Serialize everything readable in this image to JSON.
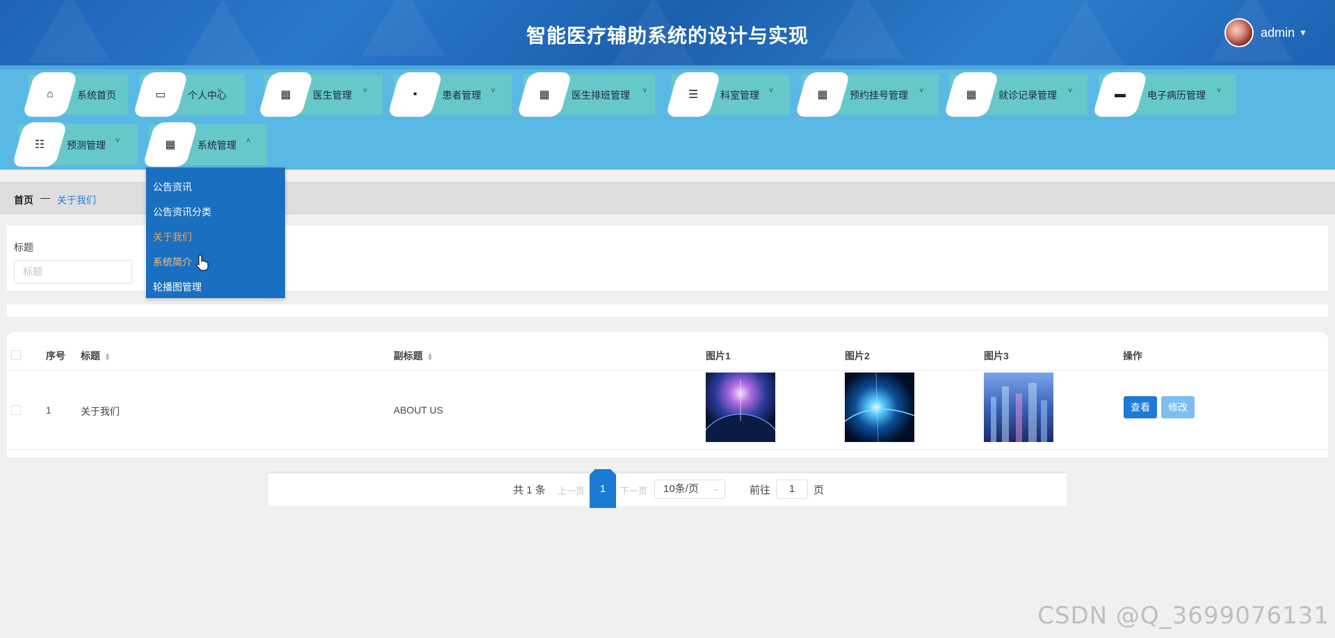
{
  "header": {
    "title": "智能医疗辅助系统的设计与实现",
    "username": "admin"
  },
  "nav": {
    "items": [
      {
        "label": "系统首页",
        "icon": "home-icon",
        "glyph": "⌂"
      },
      {
        "label": "个人中心",
        "icon": "card-icon",
        "glyph": "▭",
        "chev": "˅"
      },
      {
        "label": "医生管理",
        "icon": "grid-icon",
        "glyph": "▦",
        "chev": "˅"
      },
      {
        "label": "患者管理",
        "icon": "chat-icon",
        "glyph": "▪",
        "chev": "˅"
      },
      {
        "label": "医生排班管理",
        "icon": "grid-icon",
        "glyph": "▦",
        "chev": "˅"
      },
      {
        "label": "科室管理",
        "icon": "list-icon",
        "glyph": "☰",
        "chev": "˅"
      },
      {
        "label": "预约挂号管理",
        "icon": "apps-icon",
        "glyph": "▦",
        "chev": "˅"
      },
      {
        "label": "就诊记录管理",
        "icon": "grid-icon",
        "glyph": "▦",
        "chev": "˅"
      },
      {
        "label": "电子病历管理",
        "icon": "briefcase-icon",
        "glyph": "▬",
        "chev": "˅"
      },
      {
        "label": "预测管理",
        "icon": "sliders-icon",
        "glyph": "☷",
        "chev": "˅"
      },
      {
        "label": "系统管理",
        "icon": "grid-icon",
        "glyph": "▦",
        "chev": "˄"
      }
    ]
  },
  "dropdown": {
    "items": [
      "公告资讯",
      "公告资讯分类",
      "关于我们",
      "系统简介",
      "轮播图管理"
    ]
  },
  "breadcrumb": {
    "home": "首页",
    "separator": "—",
    "current": "关于我们"
  },
  "search": {
    "label": "标题",
    "placeholder": "标题"
  },
  "table": {
    "headers": {
      "index": "序号",
      "title": "标题",
      "subtitle": "副标题",
      "img1": "图片1",
      "img2": "图片2",
      "img3": "图片3",
      "actions": "操作"
    },
    "rows": [
      {
        "index": "1",
        "title": "关于我们",
        "subtitle": "ABOUT US"
      }
    ],
    "view_label": "查看",
    "edit_label": "修改"
  },
  "pagination": {
    "total": "共 1 条",
    "prev": "上一页",
    "current": "1",
    "next": "下一页",
    "page_size": "10条/页",
    "goto": "前往",
    "goto_value": "1",
    "page_unit": "页"
  },
  "watermark": "CSDN @Q_3699076131",
  "colors": {
    "header": "#1f63b6",
    "navbar": "#5ab9e4",
    "nav_item": "#67c8c9",
    "dropdown": "#1b6fc1",
    "primary": "#1d7ad6",
    "edit": "#7bbef0"
  }
}
